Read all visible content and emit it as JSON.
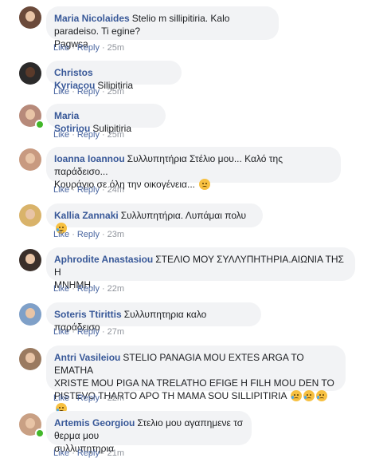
{
  "actions": {
    "like": "Like",
    "reply": "Reply",
    "sep": "·"
  },
  "colors": {
    "author": "#385898",
    "bubble": "#f2f3f5",
    "action_link": "#4b67a1",
    "meta": "#90949c",
    "online": "#42b72a"
  },
  "comments": [
    {
      "author": "Maria Nicolaides",
      "text_line1": "Stelio m sillipitiria. Kalo paradeiso. Ti egine?",
      "text_line2": "Pagwsa",
      "time": "25m",
      "online": false,
      "avatar_bg": "#6b4a3a"
    },
    {
      "author": "Christos Kyriacou",
      "text": "Silipitiria",
      "time": "25m",
      "online": false,
      "avatar_bg": "#2b2a2a"
    },
    {
      "author": "Maria Sotiriou",
      "text": "Sulipitiria",
      "time": "25m",
      "online": true,
      "avatar_bg": "#b78a7a"
    },
    {
      "author": "Ioanna Ioannou",
      "text_line1": "Συλλυπητήρια Στέλιο μου... Καλό της παράδεισο...",
      "text_line2": "Κουράγιο σε όλη την οικογένεια...",
      "time": "24m",
      "online": false,
      "avatar_bg": "#c89a80",
      "emoji": "sad-face-emoji"
    },
    {
      "author": "Kallia Zannaki",
      "text": "Συλλυπητήρια. Λυπάμαι πολυ",
      "time": "23m",
      "online": false,
      "avatar_bg": "#d9b36a",
      "emoji": "crying-face-emoji"
    },
    {
      "author": "Aphrodite Anastasiou",
      "text_line1": "ΣΤΕΛΙΟ ΜΟΥ ΣΥΛΛΥΠΗΤΗΡΙΑ.ΑΙΩΝΙΑ ΤΗΣ Η",
      "text_line2": "ΜΝΗΜΗ.",
      "time": "22m",
      "online": false,
      "avatar_bg": "#3a2f2a"
    },
    {
      "author": "Soteris Ttirittis",
      "text": "Συλλυπητηρια καλο παράδεισο",
      "time": "27m",
      "online": false,
      "avatar_bg": "#7fa0c8"
    },
    {
      "author": "Antri Vasileiou",
      "text_line1": "STELIO PANAGIA MOU EXTES ARGA TO EMATHA",
      "text_line2": "XRISTE MOU PIGA NA TRELATHO EFIGE H FILH MOU DEN TO",
      "text_line3": "PISTEVO THARTO APO TH MAMA SOU SILLIPITIRIA",
      "time": "22m",
      "online": false,
      "avatar_bg": "#9a7a60",
      "emoji": "crying-face-emoji"
    },
    {
      "author": "Artemis Georgiou",
      "text_line1": "Στελιο μου αγαπημενε τσ θερμα μου",
      "text_line2": "συλλυπητηρια",
      "time": "21m",
      "online": true,
      "avatar_bg": "#c9a084"
    }
  ]
}
